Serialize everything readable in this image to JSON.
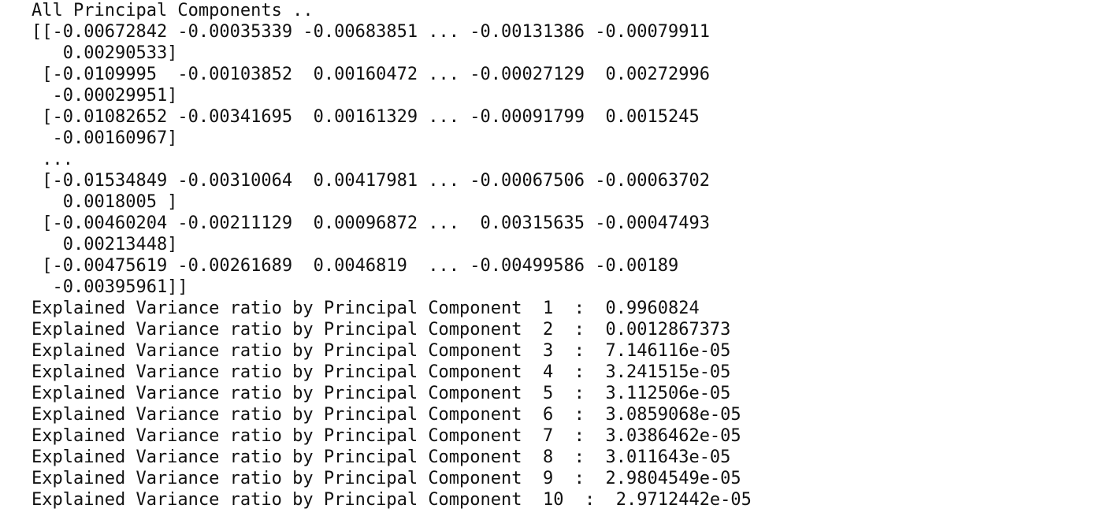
{
  "console": {
    "lines": [
      "All Principal Components ..",
      "[[-0.00672842 -0.00035339 -0.00683851 ... -0.00131386 -0.00079911",
      "   0.00290533]",
      " [-0.0109995  -0.00103852  0.00160472 ... -0.00027129  0.00272996",
      "  -0.00029951]",
      " [-0.01082652 -0.00341695  0.00161329 ... -0.00091799  0.0015245",
      "  -0.00160967]",
      " ...",
      " [-0.01534849 -0.00310064  0.00417981 ... -0.00067506 -0.00063702",
      "   0.0018005 ]",
      " [-0.00460204 -0.00211129  0.00096872 ...  0.00315635 -0.00047493",
      "   0.00213448]",
      " [-0.00475619 -0.00261689  0.0046819  ... -0.00499586 -0.00189",
      "  -0.00395961]]",
      "Explained Variance ratio by Principal Component  1  :  0.9960824",
      "Explained Variance ratio by Principal Component  2  :  0.0012867373",
      "Explained Variance ratio by Principal Component  3  :  7.146116e-05",
      "Explained Variance ratio by Principal Component  4  :  3.241515e-05",
      "Explained Variance ratio by Principal Component  5  :  3.112506e-05",
      "Explained Variance ratio by Principal Component  6  :  3.0859068e-05",
      "Explained Variance ratio by Principal Component  7  :  3.0386462e-05",
      "Explained Variance ratio by Principal Component  8  :  3.011643e-05",
      "Explained Variance ratio by Principal Component  9  :  2.9804549e-05",
      "Explained Variance ratio by Principal Component  10  :  2.9712442e-05"
    ]
  }
}
